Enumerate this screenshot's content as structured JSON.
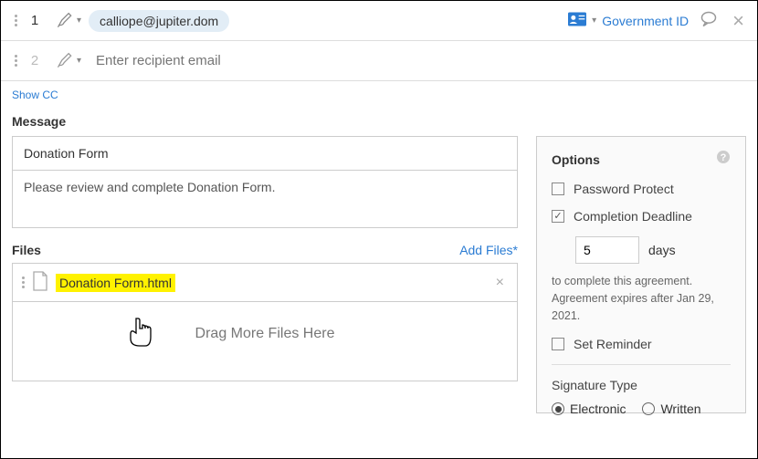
{
  "recipients": [
    {
      "num": "1",
      "email": "calliope@jupiter.dom",
      "idLabel": "Government ID"
    },
    {
      "num": "2",
      "placeholder": "Enter recipient email"
    }
  ],
  "showCC": "Show CC",
  "message": {
    "label": "Message",
    "subject": "Donation Form",
    "body": "Please review and complete Donation Form."
  },
  "files": {
    "label": "Files",
    "addLabel": "Add Files*",
    "items": [
      {
        "name": "Donation Form.html"
      }
    ],
    "dropHint": "Drag More Files Here"
  },
  "options": {
    "title": "Options",
    "passwordProtect": "Password Protect",
    "completionDeadline": "Completion Deadline",
    "daysValue": "5",
    "daysLabel": "days",
    "note1": "to complete this agreement.",
    "note2": "Agreement expires after Jan 29, 2021.",
    "setReminder": "Set Reminder",
    "sigTypeLabel": "Signature Type",
    "sigElectronic": "Electronic",
    "sigWritten": "Written"
  }
}
